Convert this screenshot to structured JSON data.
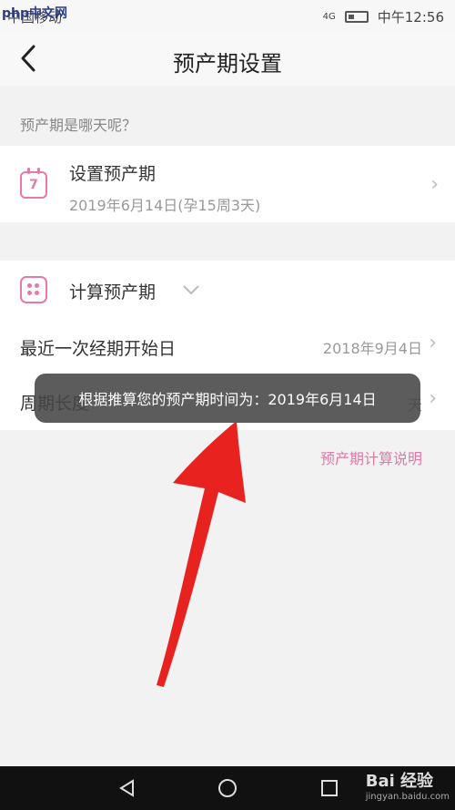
{
  "status": {
    "carrier": "中国移动",
    "watermark": "php中文网",
    "time": "中午12:56",
    "signal": "4G"
  },
  "header": {
    "title": "预产期设置"
  },
  "section_label": "预产期是哪天呢？",
  "set_card": {
    "title": "设置预产期",
    "subtitle": "2019年6月14日(孕15周3天)",
    "icon_number": "7"
  },
  "calc_card": {
    "title": "计算预产期",
    "last_period_label": "最近一次经期开始日",
    "last_period_value": "2018年9月4日",
    "cycle_label": "周期长度",
    "cycle_value": "天"
  },
  "toast": "根据推算您的预产期时间为：2019年6月14日",
  "explain_link": "预产期计算说明",
  "footer": {
    "baidu": "Bai 经验",
    "baidu_url": "jingyan.baidu.com"
  },
  "colors": {
    "accent": "#e878a8",
    "arrow": "#e8231f"
  }
}
